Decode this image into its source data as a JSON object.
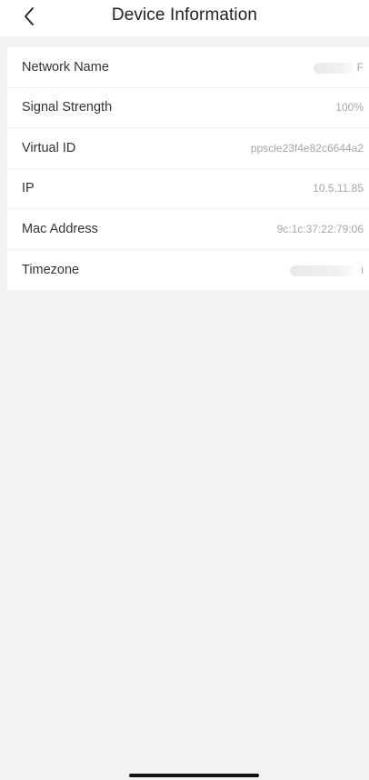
{
  "header": {
    "title": "Device Information"
  },
  "icons": {
    "back": "back-chevron-icon"
  },
  "rows": [
    {
      "label": "Network Name",
      "value": "F",
      "redacted": true
    },
    {
      "label": "Signal Strength",
      "value": "100%"
    },
    {
      "label": "Virtual ID",
      "value": "ppscle23f4e82c6644a2"
    },
    {
      "label": "IP",
      "value": "10.5.11.85"
    },
    {
      "label": "Mac Address",
      "value": "9c:1c:37:22:79:06"
    },
    {
      "label": "Timezone",
      "value": "i",
      "redacted": true
    }
  ]
}
